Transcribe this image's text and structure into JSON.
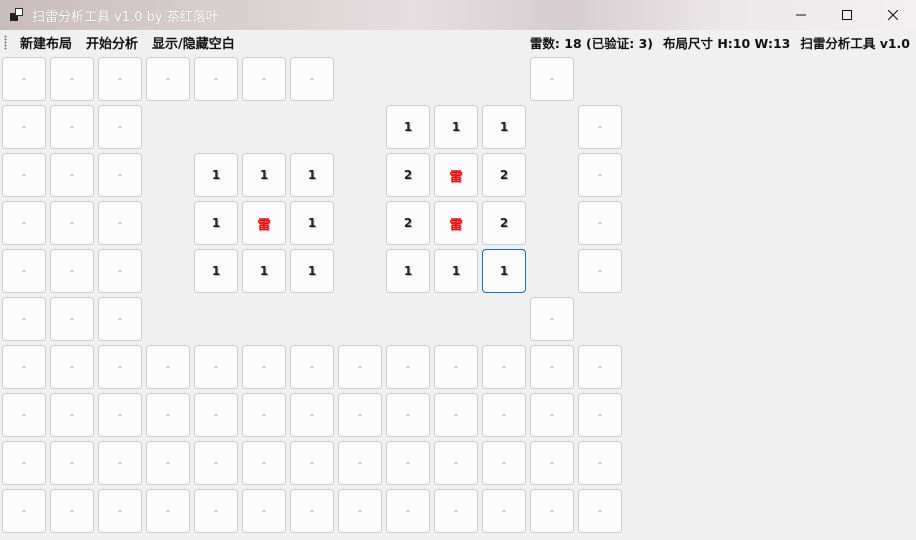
{
  "window": {
    "title": "扫雷分析工具 v1.0 by 茶红落叶",
    "icon": "app-icon",
    "controls": {
      "minimize_icon": "minimize-icon",
      "maximize_icon": "maximize-icon",
      "close_icon": "close-icon"
    }
  },
  "menu": {
    "items": [
      "新建布局",
      "开始分析",
      "显示/隐藏空白"
    ]
  },
  "status": {
    "mine_count": "雷数: 18 (已验证: 3)",
    "layout_size": "布局尺寸 H:10 W:13",
    "app_name": "扫雷分析工具 v1.0"
  },
  "board": {
    "rows": 10,
    "cols": 13,
    "unknown_symbol": "-",
    "mine_symbol": "雷",
    "selected_cell": [
      4,
      10
    ],
    "grid": [
      "UUUUUUU____U_",
      "UUU_____111_U",
      "UUU_111_2M2_U",
      "UUU_1M1_2M2_U",
      "UUU_111_111_U",
      "UUU________U_",
      "UUUUUUUUUUUUU",
      "UUUUUUUUUUUUU",
      "UUUUUUUUUUUUU",
      "UUUUUUUUUUUUU"
    ]
  }
}
